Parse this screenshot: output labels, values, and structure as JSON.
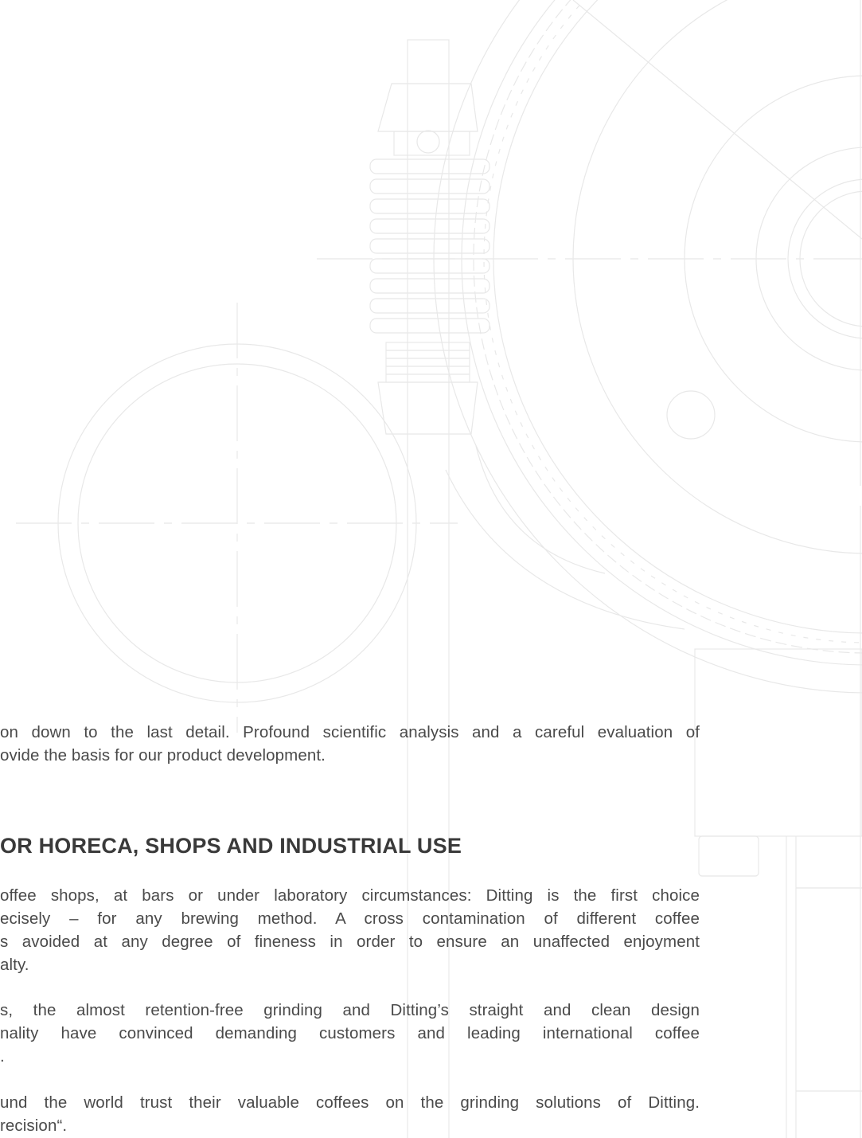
{
  "intro": {
    "line1": "on down to the last detail. Profound scientific analysis and a careful evaluation of",
    "line2": "ovide the basis for our product development."
  },
  "section": {
    "heading": "OR HORECA, SHOPS AND INDUSTRIAL USE",
    "para1": [
      "offee shops, at bars or under laboratory circumstances: Ditting is the first choice",
      "ecisely – for any brewing method. A cross contamination of different coffee",
      "s avoided at any degree of fineness in order to ensure an unaffected enjoyment",
      "alty."
    ],
    "para2": [
      "s, the almost retention-free grinding and Ditting’s straight and clean design",
      "nality have convinced demanding customers and leading international coffee",
      "."
    ],
    "para3": [
      "und the world trust their valuable coffees on the grinding solutions of Ditting.",
      "recision“."
    ]
  },
  "colors": {
    "text": "#4a4a4a",
    "heading": "#3a3a3a",
    "drawing_lines": "#e6e6e6"
  }
}
